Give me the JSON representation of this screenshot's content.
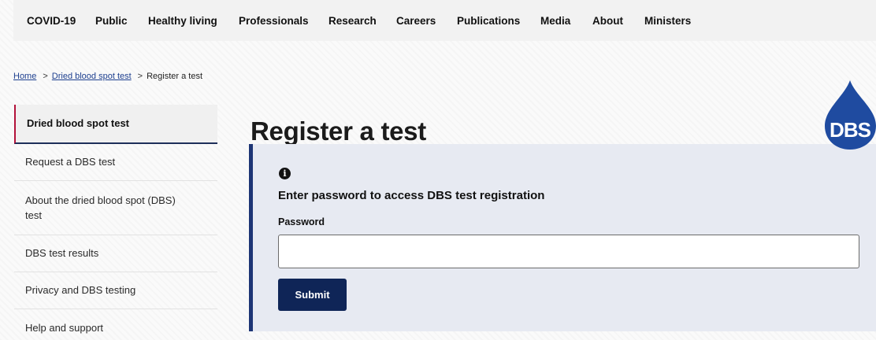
{
  "topnav": {
    "items": [
      {
        "label": "COVID-19"
      },
      {
        "label": "Public"
      },
      {
        "label": "Healthy living"
      },
      {
        "label": "Professionals"
      },
      {
        "label": "Research"
      },
      {
        "label": "Careers"
      },
      {
        "label": "Publications"
      },
      {
        "label": "Media"
      },
      {
        "label": "About"
      },
      {
        "label": "Ministers"
      }
    ]
  },
  "breadcrumb": {
    "items": [
      {
        "label": "Home"
      },
      {
        "label": "Dried blood spot test"
      },
      {
        "label": "Register a test"
      }
    ],
    "separator": ">"
  },
  "sidenav": {
    "items": [
      {
        "label": "Dried blood spot test",
        "active": true
      },
      {
        "label": "Request a DBS test"
      },
      {
        "label": "About the dried blood spot (DBS) test"
      },
      {
        "label": "DBS test results"
      },
      {
        "label": "Privacy and DBS testing"
      },
      {
        "label": "Help and support"
      }
    ]
  },
  "main": {
    "title": "Register a test",
    "panel": {
      "info_icon": "info-icon",
      "info_glyph": "i",
      "heading": "Enter password to access DBS test registration",
      "password_label": "Password",
      "password_value": "",
      "submit_label": "Submit"
    }
  },
  "logo": {
    "text": "DBS"
  },
  "colors": {
    "panel_bg": "#e7eaf2",
    "panel_border": "#1d3575",
    "button_bg": "#0f2557",
    "logo_blue": "#1f4ba0",
    "active_accent": "#b3123a",
    "link": "#1d3f8f"
  }
}
